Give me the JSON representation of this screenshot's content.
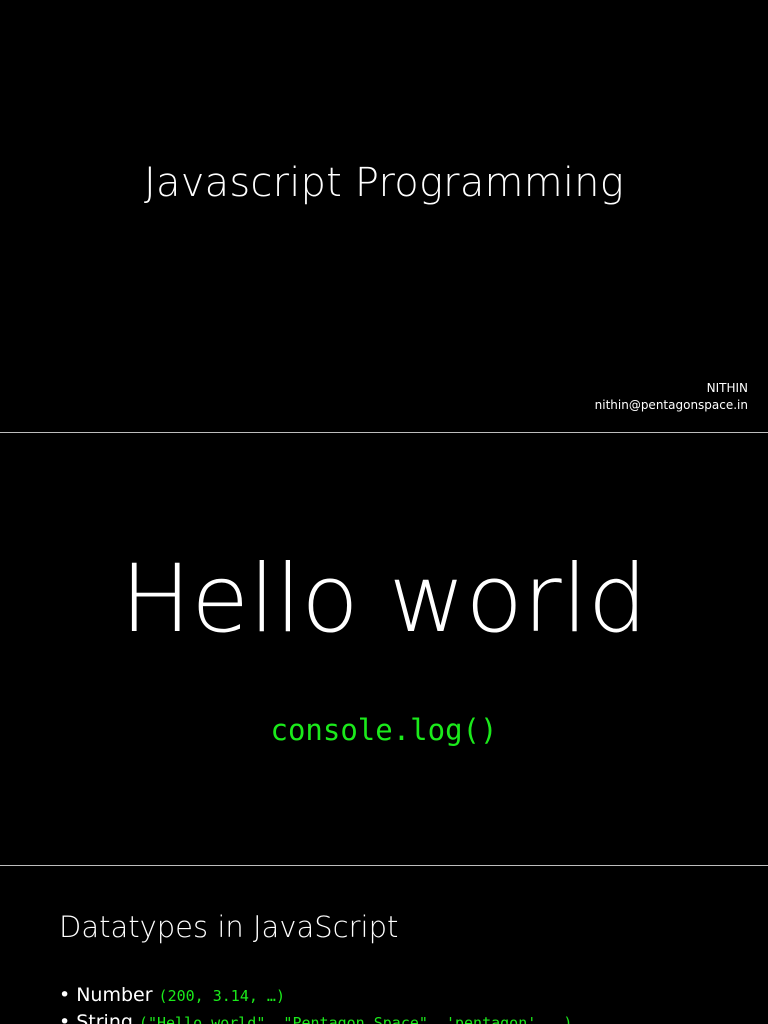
{
  "slide1": {
    "title": "Javascript Programming",
    "author_name": "NITHIN",
    "author_email": "nithin@pentagonspace.in"
  },
  "slide2": {
    "heading": "Hello world",
    "code": "console.log()"
  },
  "slide3": {
    "heading": "Datatypes in JavaScript",
    "bullets": [
      {
        "label": "Number",
        "example": "(200, 3.14, …)"
      },
      {
        "label": "String",
        "example": "(\"Hello world\", \"Pentagon Space\", 'pentagon', …)"
      }
    ]
  },
  "colors": {
    "background": "#000000",
    "text": "#ffffff",
    "code": "#1bea1b",
    "divider": "#bdbdbd"
  }
}
